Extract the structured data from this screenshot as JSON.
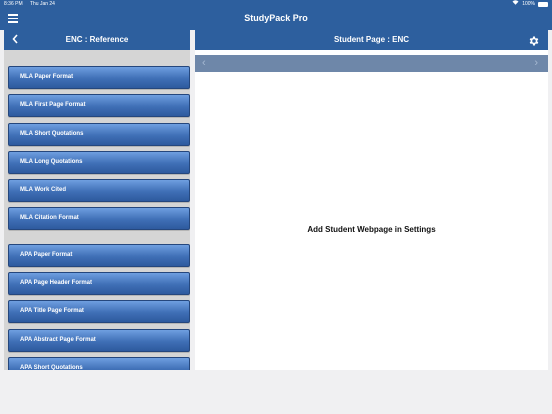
{
  "status_bar": {
    "time": "8:36 PM",
    "date": "Thu Jan 24",
    "battery": "100%"
  },
  "app": {
    "title": "StudyPack Pro",
    "menu_icon": "hamburger-icon"
  },
  "left_panel": {
    "title": "ENC : Reference",
    "back_icon": "chevron-left-icon",
    "items": [
      {
        "label": "MLA Paper Format"
      },
      {
        "label": "MLA First Page Format"
      },
      {
        "label": "MLA Short Quotations"
      },
      {
        "label": "MLA Long Quotations"
      },
      {
        "label": "MLA Work Cited"
      },
      {
        "label": "MLA Citation Format"
      },
      {
        "label": "APA Paper Format"
      },
      {
        "label": "APA Page Header Format"
      },
      {
        "label": "APA Title Page Format"
      },
      {
        "label": "APA Abstract Page Format"
      },
      {
        "label": "APA Short Quotations"
      }
    ]
  },
  "right_panel": {
    "title": "Student Page : ENC",
    "settings_icon": "gear-icon",
    "back_arrow": "‹",
    "forward_arrow": "›",
    "message": "Add Student Webpage in Settings"
  },
  "colors": {
    "nav_blue": "#2d5f9e",
    "button_blue": "#3f6fb6",
    "panel_gray": "#d5d5d5",
    "browser_bar": "#6e87a9"
  }
}
